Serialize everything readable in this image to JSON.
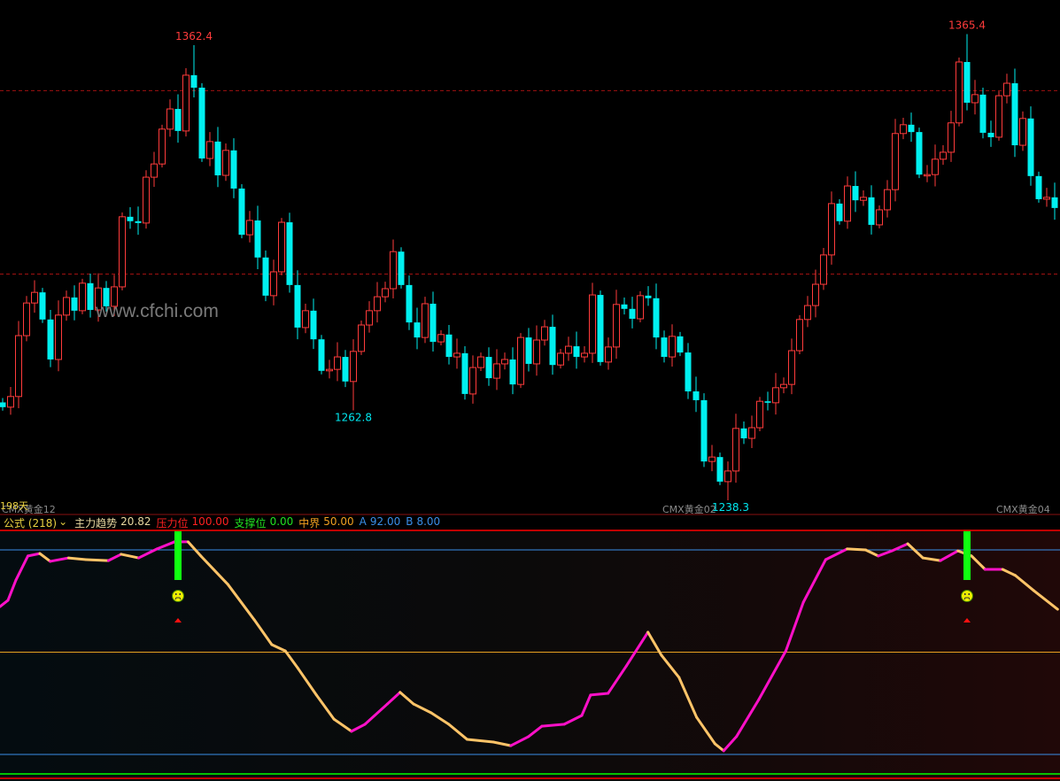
{
  "watermark": "www.cfchi.com",
  "footer": {
    "days_label": "198天",
    "contract_left": "CMX黄金12",
    "contract_mid": "CMX黄金02",
    "contract_right": "CMX黄金04",
    "low_value": "1238.3"
  },
  "indicator_header": {
    "formula": "公式 (218)",
    "dropdown_icon": "chevron-down-icon",
    "trend_label": "主力趋势",
    "trend_value": "20.82",
    "pressure_label": "压力位",
    "pressure_value": "100.00",
    "support_label": "支撑位",
    "support_value": "0.00",
    "mid_label": "中界",
    "mid_value": "50.00",
    "a_label": "A",
    "a_value": "92.00",
    "b_label": "B",
    "b_value": "8.00"
  },
  "colors": {
    "up": "#ff3b3b",
    "down": "#00f0f0",
    "rise": "#ff10c8",
    "fall": "#ffc468",
    "pressure": "#ff0000",
    "support": "#00ff00",
    "mid": "#e8a020",
    "ab": "#3a8ee8"
  },
  "chart_data": [
    {
      "type": "candlestick",
      "title": "CMX黄金",
      "y_range": [
        1237,
        1375
      ],
      "reference_lines": [
        1350,
        1300
      ],
      "first_open": 1265.0,
      "closes": [
        1263.7,
        1266.6,
        1283.2,
        1292.1,
        1295.0,
        1287.6,
        1276.7,
        1288.8,
        1293.6,
        1290.0,
        1297.5,
        1290.2,
        1296.2,
        1291.2,
        1296.5,
        1315.6,
        1314.4,
        1313.9,
        1326.4,
        1330.0,
        1339.5,
        1345.0,
        1339.0,
        1354.2,
        1350.8,
        1331.5,
        1336.1,
        1326.9,
        1333.7,
        1323.3,
        1310.7,
        1314.6,
        1304.5,
        1294.1,
        1300.6,
        1314.1,
        1297.0,
        1285.4,
        1290.0,
        1282.2,
        1273.6,
        1274.0,
        1277.4,
        1270.7,
        1278.9,
        1286.1,
        1290.0,
        1293.8,
        1296.0,
        1306.1,
        1297.0,
        1286.8,
        1282.7,
        1291.9,
        1281.5,
        1283.5,
        1277.4,
        1278.4,
        1267.3,
        1274.5,
        1277.4,
        1271.6,
        1275.5,
        1276.7,
        1269.9,
        1282.7,
        1275.5,
        1282.0,
        1285.6,
        1275.2,
        1278.4,
        1280.3,
        1277.4,
        1278.4,
        1294.3,
        1276.0,
        1280.1,
        1291.7,
        1290.5,
        1287.8,
        1294.1,
        1293.4,
        1282.7,
        1277.4,
        1283.0,
        1278.6,
        1268.0,
        1265.6,
        1248.9,
        1250.1,
        1243.4,
        1246.3,
        1257.9,
        1255.2,
        1258.1,
        1265.3,
        1264.9,
        1269.0,
        1269.9,
        1279.1,
        1287.6,
        1291.4,
        1297.2,
        1305.2,
        1319.2,
        1314.4,
        1324.0,
        1320.1,
        1320.9,
        1313.4,
        1317.5,
        1323.0,
        1338.3,
        1340.7,
        1338.7,
        1327.1,
        1327.1,
        1331.3,
        1333.2,
        1341.2,
        1357.8,
        1346.7,
        1348.9,
        1338.5,
        1337.3,
        1348.6,
        1352.0,
        1335.1,
        1342.4,
        1326.7,
        1320.4,
        1320.9,
        1318.0
      ],
      "extremes": [
        {
          "index": 24,
          "kind": "high",
          "value": 1362.4,
          "label": "1362.4"
        },
        {
          "index": 44,
          "kind": "low",
          "value": 1262.8,
          "label": "1262.8"
        },
        {
          "index": 91,
          "kind": "low",
          "value": 1238.3,
          "label": "1238.3"
        },
        {
          "index": 121,
          "kind": "high",
          "value": 1365.4,
          "label": "1365.4"
        }
      ]
    },
    {
      "type": "line",
      "title": "主力趋势",
      "y_range": [
        0,
        100
      ],
      "levels": {
        "pressure": 100,
        "a": 92,
        "mid": 50,
        "b": 8,
        "support": 0
      },
      "points": [
        [
          0,
          68.7
        ],
        [
          1,
          71.3
        ],
        [
          2,
          79.6
        ],
        [
          3.5,
          89.5
        ],
        [
          5,
          90.5
        ],
        [
          6.3,
          87.3
        ],
        [
          8.6,
          88.7
        ],
        [
          10.8,
          88.0
        ],
        [
          13.6,
          87.6
        ],
        [
          15.2,
          90.2
        ],
        [
          17.4,
          88.7
        ],
        [
          19.7,
          92.4
        ],
        [
          21.9,
          95.3
        ],
        [
          23.6,
          95.3
        ],
        [
          25.2,
          89.5
        ],
        [
          28.6,
          77.8
        ],
        [
          31.9,
          63.3
        ],
        [
          34.1,
          53.1
        ],
        [
          35.8,
          50.5
        ],
        [
          37.4,
          43.3
        ],
        [
          39.7,
          32.4
        ],
        [
          41.9,
          22.5
        ],
        [
          44.1,
          17.5
        ],
        [
          45.8,
          20.4
        ],
        [
          48.6,
          28.7
        ],
        [
          50.2,
          33.5
        ],
        [
          51.9,
          28.7
        ],
        [
          54.1,
          25.1
        ],
        [
          56.3,
          20.4
        ],
        [
          58.6,
          14.2
        ],
        [
          61.9,
          13.1
        ],
        [
          64.1,
          11.6
        ],
        [
          66.3,
          15.3
        ],
        [
          68,
          19.6
        ],
        [
          70.8,
          20.4
        ],
        [
          73,
          24.0
        ],
        [
          74.1,
          32.4
        ],
        [
          76.3,
          33.1
        ],
        [
          78.6,
          44.4
        ],
        [
          81.3,
          58.2
        ],
        [
          83,
          48.7
        ],
        [
          85.2,
          39.6
        ],
        [
          87.4,
          23.3
        ],
        [
          89.7,
          12.4
        ],
        [
          90.8,
          9.5
        ],
        [
          92.4,
          15.3
        ],
        [
          95.2,
          30.5
        ],
        [
          98.6,
          50.5
        ],
        [
          100.8,
          70.5
        ],
        [
          103.6,
          88.0
        ],
        [
          106.3,
          92.4
        ],
        [
          108.6,
          92.0
        ],
        [
          110.2,
          89.5
        ],
        [
          111.9,
          91.6
        ],
        [
          113.9,
          94.5
        ],
        [
          115.8,
          88.7
        ],
        [
          118,
          87.6
        ],
        [
          120.2,
          91.6
        ],
        [
          121.9,
          89.5
        ],
        [
          123.6,
          84.0
        ],
        [
          125.8,
          84.0
        ],
        [
          127.4,
          81.5
        ],
        [
          129.7,
          75.3
        ],
        [
          132.7,
          67.6
        ]
      ],
      "signals": [
        {
          "index": 22,
          "bar_top": 100,
          "bar_bottom": 80
        },
        {
          "index": 121,
          "bar_top": 100,
          "bar_bottom": 80
        }
      ]
    }
  ]
}
